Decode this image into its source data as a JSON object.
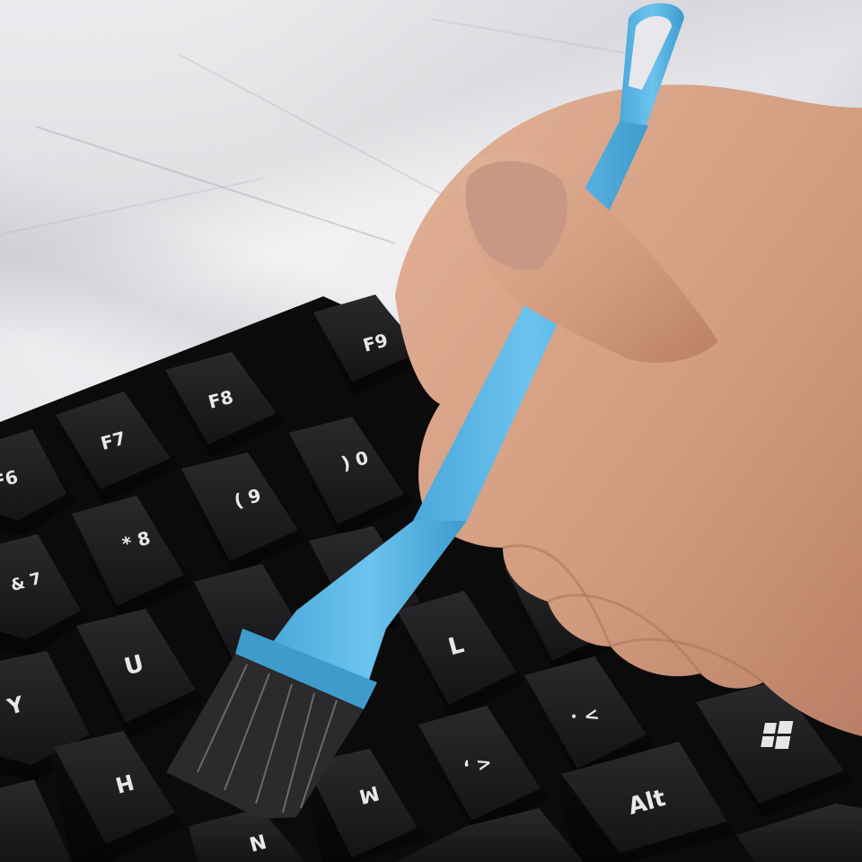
{
  "scene": {
    "background": "white marble surface",
    "colors": {
      "brush": "#5bb7e6",
      "keycap": "#1c1c1e",
      "legend": "#e6e6e6",
      "skin": "#d9a488"
    }
  },
  "keys": [
    {
      "label": "F6"
    },
    {
      "label": "F7"
    },
    {
      "label": "F8"
    },
    {
      "label": "F9"
    },
    {
      "label": "*\n8"
    },
    {
      "label": "(\n9"
    },
    {
      "label": ")\n0"
    },
    {
      "label": "&\n7"
    },
    {
      "label": "U"
    },
    {
      "label": "Y"
    },
    {
      "label": "H"
    },
    {
      "label": "L"
    },
    {
      "label": "<\n,"
    },
    {
      "label": ">\n."
    },
    {
      "label": "Alt"
    },
    {
      "label": "N"
    },
    {
      "label": "M"
    }
  ],
  "icons": [
    "windows-logo-icon"
  ]
}
